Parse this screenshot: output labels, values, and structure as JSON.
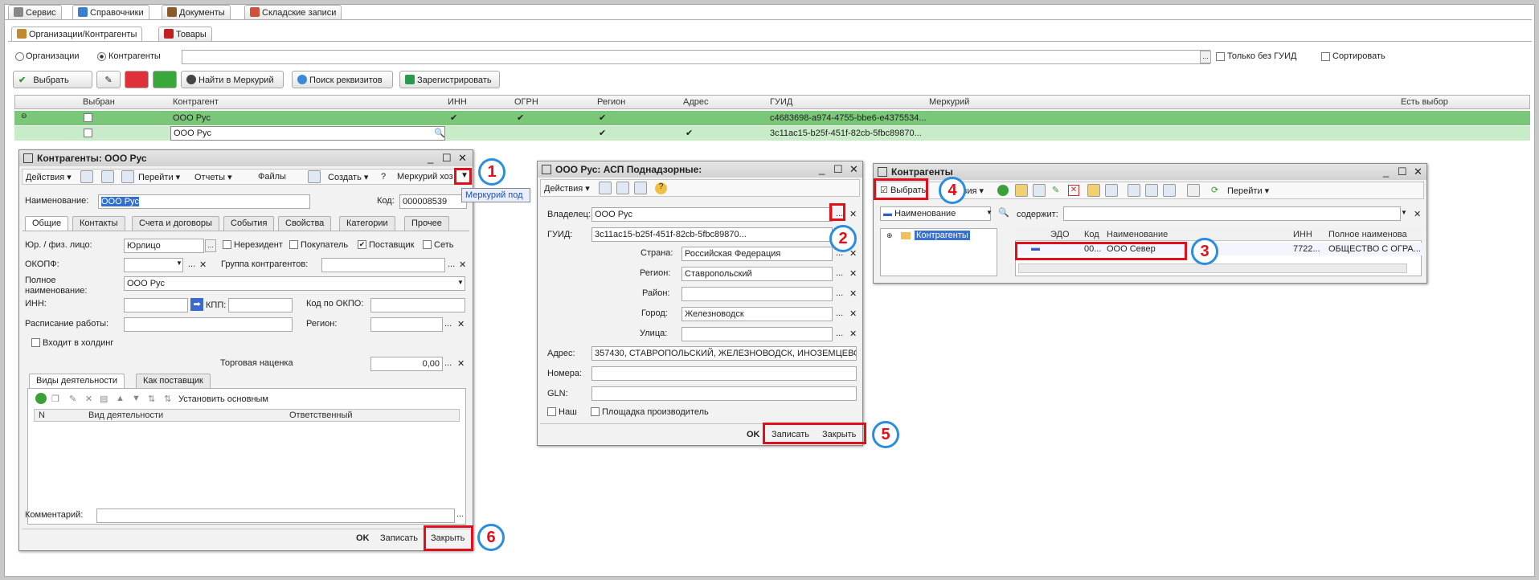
{
  "top_tabs": [
    "Сервис",
    "Справочники",
    "Документы",
    "Складские записи"
  ],
  "sub_tabs": [
    "Организации/Контрагенты",
    "Товары"
  ],
  "radio": {
    "org": "Организации",
    "kontr": "Контрагенты"
  },
  "filters": {
    "only_no_guid": "Только без ГУИД",
    "sort": "Сортировать"
  },
  "toolbar": {
    "select": "Выбрать",
    "find_mercury": "Найти в Меркурий",
    "search_req": "Поиск реквизитов",
    "register": "Зарегистрировать"
  },
  "grid": {
    "headers": [
      "Выбран",
      "Контрагент",
      "ИНН",
      "ОГРН",
      "Регион",
      "Адрес",
      "ГУИД",
      "Меркурий",
      "Есть выбор"
    ],
    "rows": [
      {
        "kontr": "ООО Рус",
        "guid": "c4683698-a974-4755-bbe6-e4375534..."
      },
      {
        "kontr": "ООО Рус",
        "guid": "3c11ac15-b25f-451f-82cb-5fbc89870..."
      }
    ]
  },
  "w1": {
    "title": "Контрагенты: ООО Рус",
    "menu": [
      "Действия",
      "Перейти",
      "Отчеты",
      "Файлы",
      "Создать",
      "Меркурий хоз"
    ],
    "dropdown": "Меркурий под",
    "name_label": "Наименование:",
    "name": "ООО Рус",
    "code_label": "Код:",
    "code": "000008539",
    "tabs": [
      "Общие",
      "Контакты",
      "Счета и договоры",
      "События",
      "Свойства",
      "Категории",
      "Прочее"
    ],
    "yur_label": "Юр. / физ. лицо:",
    "yur": "Юрлицо",
    "nerez": "Нерезидент",
    "pokup": "Покупатель",
    "postav": "Поставщик",
    "set": "Сеть",
    "okopf": "ОКОПФ:",
    "group": "Группа контрагентов:",
    "fullname_label": "Полное наименование:",
    "fullname": "ООО Рус",
    "inn": "ИНН:",
    "kpp": "КПП:",
    "okpo": "Код по ОКПО:",
    "schedule": "Расписание работы:",
    "region": "Регион:",
    "holding": "Входит в холдинг",
    "markup_label": "Торговая наценка",
    "markup": "0,00",
    "inner_tabs": [
      "Виды деятельности",
      "Как поставщик"
    ],
    "set_main": "Установить основным",
    "cols": [
      "N",
      "Вид деятельности",
      "Ответственный"
    ],
    "comment": "Комментарий:",
    "ok": "OK",
    "save": "Записать",
    "close": "Закрыть"
  },
  "w2": {
    "title": "ООО Рус: АСП Поднадзорные:",
    "menu": "Действия",
    "owner_label": "Владелец:",
    "owner": "ООО Рус",
    "guid_label": "ГУИД:",
    "guid": "3c11ac15-b25f-451f-82cb-5fbc89870...",
    "country_label": "Страна:",
    "country": "Российская Федерация",
    "region_label": "Регион:",
    "region": "Ставропольский",
    "district_label": "Район:",
    "city_label": "Город:",
    "city": "Железноводск",
    "street_label": "Улица:",
    "address_label": "Адрес:",
    "address": "357430, СТАВРОПОЛЬСКИЙ, ЖЕЛЕЗНОВОДСК, ИНОЗЕМЦЕВО",
    "numbers_label": "Номера:",
    "gln_label": "GLN:",
    "nash": "Наш",
    "producer": "Площадка производитель",
    "ok": "OK",
    "save": "Записать",
    "close": "Закрыть"
  },
  "w3": {
    "title": "Контрагенты",
    "select": "Выбрать",
    "actions": "ствия",
    "goto": "Перейти",
    "filter_field": "Наименование",
    "contains": "содержит:",
    "tree_root": "Контрагенты",
    "cols": [
      "ЭДО",
      "Код",
      "Наименование",
      "ИНН",
      "Полное наименова"
    ],
    "row": {
      "code": "00...",
      "name": "ООО Север",
      "inn": "7722...",
      "full": "ОБЩЕСТВО С ОГРА..."
    }
  },
  "markers": [
    "1",
    "2",
    "3",
    "4",
    "5",
    "6"
  ]
}
